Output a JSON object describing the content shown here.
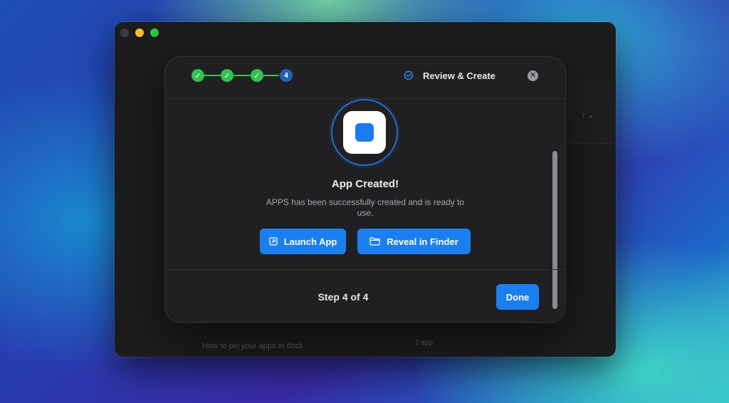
{
  "background_window": {
    "footer_left": "How to pin your apps to dock",
    "footer_right": "1 app",
    "sort_icon": "arrow-up-chevron-icon"
  },
  "wizard": {
    "steps": [
      {
        "label": "✓",
        "status": "complete"
      },
      {
        "label": "✓",
        "status": "complete"
      },
      {
        "label": "✓",
        "status": "complete"
      },
      {
        "label": "4",
        "status": "current"
      }
    ],
    "header_title": "Review & Create",
    "close_icon": "✕",
    "success_title": "App Created!",
    "success_message": "APPS has been successfully created and is ready to use.",
    "launch_label": "Launch App",
    "reveal_label": "Reveal in Finder",
    "step_label": "Step 4 of 4",
    "done_label": "Done"
  },
  "colors": {
    "accent": "#1b7ff0",
    "success": "#31c24f",
    "current_step": "#1f63b3",
    "modal_bg": "#202022",
    "window_bg": "#1c1c1e"
  }
}
